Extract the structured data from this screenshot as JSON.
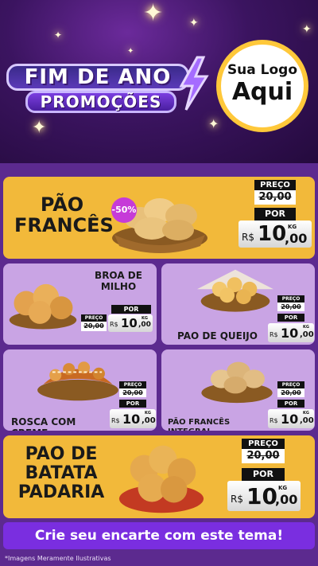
{
  "header": {
    "title_line1": "FIM DE ANO",
    "title_line2": "PROMOÇÕES",
    "logo_line1": "Sua Logo",
    "logo_line2": "Aqui"
  },
  "labels": {
    "preco": "PREÇO",
    "por": "POR",
    "currency": "R$",
    "kg": "KG"
  },
  "products": [
    {
      "name": "PÃO FRANCÊS",
      "badge": "-50%",
      "old_price": "20,00",
      "price_int": "10",
      "price_dec": ",00"
    },
    {
      "name": "BROA DE MILHO",
      "old_price": "20,00",
      "price_int": "10",
      "price_dec": ",00"
    },
    {
      "name": "PAO DE QUEIJO",
      "old_price": "20,00",
      "price_int": "10",
      "price_dec": ",00"
    },
    {
      "name": "ROSCA COM CREME",
      "old_price": "20,00",
      "price_int": "10",
      "price_dec": ",00"
    },
    {
      "name": "PÃO FRANCÊS INTEGRAL",
      "old_price": "20,00",
      "price_int": "10",
      "price_dec": ",00"
    },
    {
      "name": "PAO DE BATATA PADARIA",
      "old_price": "20,00",
      "price_int": "10",
      "price_dec": ",00"
    }
  ],
  "cta": "Crie seu encarte com este tema!",
  "footnote": "*Imagens Meramente Ilustrativas"
}
